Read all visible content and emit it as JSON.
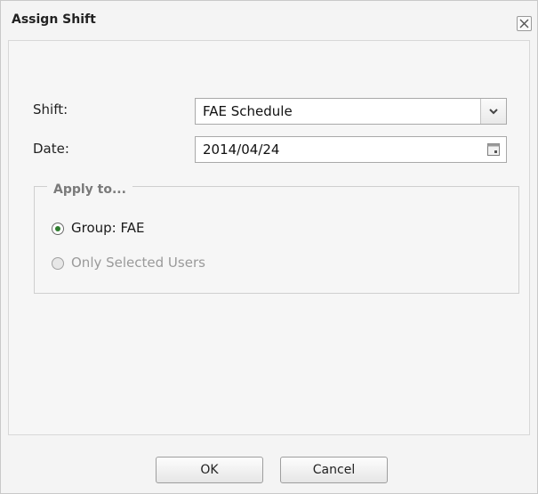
{
  "dialog": {
    "title": "Assign Shift"
  },
  "form": {
    "shift_label": "Shift:",
    "shift_value": "FAE Schedule",
    "date_label": "Date:",
    "date_value": "2014/04/24"
  },
  "apply_to": {
    "legend": "Apply to...",
    "options": [
      {
        "label": "Group: FAE",
        "selected": true,
        "enabled": true
      },
      {
        "label": "Only Selected Users",
        "selected": false,
        "enabled": false
      }
    ]
  },
  "buttons": {
    "ok": "OK",
    "cancel": "Cancel"
  },
  "colors": {
    "radio_selected": "#2f7d2f",
    "disabled_text": "#9a9a9a"
  }
}
